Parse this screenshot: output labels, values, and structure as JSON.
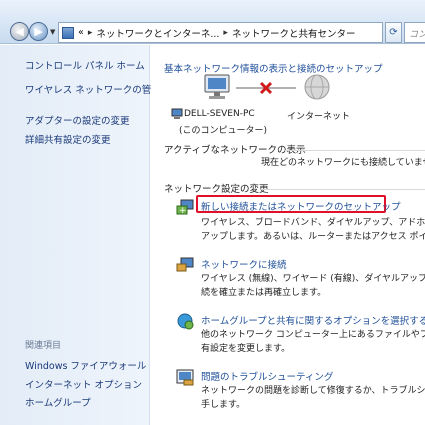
{
  "address": {
    "crumbs": [
      "«",
      "ネットワークとインターネ...",
      "ネットワークと共有センター"
    ],
    "search_placeholder": "コン"
  },
  "sidebar": {
    "links": [
      "コントロール パネル ホーム",
      "ワイヤレス ネットワークの管理",
      "アダプターの設定の変更",
      "詳細共有設定の変更"
    ],
    "related_heading": "関連項目",
    "related_links": [
      "Windows ファイアウォール",
      "インターネット オプション",
      "ホームグループ"
    ]
  },
  "main": {
    "basic_heading": "基本ネットワーク情報の表示と接続のセットアップ",
    "map": {
      "computer_label_1": "DELL-SEVEN-PC",
      "computer_label_2": "(このコンピューター)",
      "internet_label": "インターネット"
    },
    "active_heading": "アクティブなネットワークの表示",
    "active_status": "現在どのネットワークにも接続していませ",
    "settings_heading": "ネットワーク設定の変更",
    "tasks": [
      {
        "title": "新しい接続またはネットワークのセットアップ",
        "desc": [
          "ワイヤレス、ブロードバンド、ダイヤルアップ、アドホッ",
          "アップします。あるいは、ルーターまたはアクセス ポイン"
        ]
      },
      {
        "title": "ネットワークに接続",
        "desc": [
          "ワイヤレス (無線)、ワイヤード (有線)、ダイヤルアップ、",
          "続を確立または再確立します。"
        ]
      },
      {
        "title": "ホームグループと共有に関するオプションを選択する",
        "desc": [
          "他のネットワーク コンピューター上にあるファイルやプ",
          "有設定を変更します。"
        ]
      },
      {
        "title": "問題のトラブルシューティング",
        "desc": [
          "ネットワークの問題を診断して修復するか、トラブルシュー",
          "手します。"
        ]
      }
    ]
  }
}
